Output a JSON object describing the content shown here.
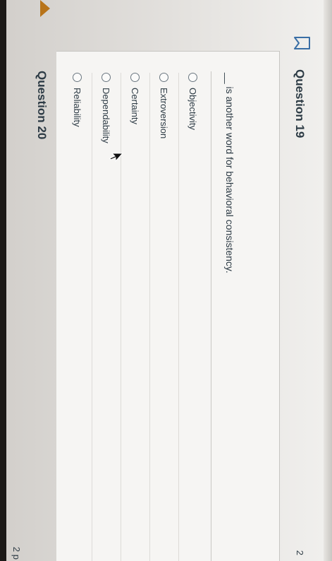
{
  "question": {
    "title": "Question 19",
    "points": "2",
    "text": "__ is another word for behavioral consistency.",
    "answers": [
      {
        "label": "Objectivity",
        "selected": false
      },
      {
        "label": "Extroversion",
        "selected": false
      },
      {
        "label": "Certainty",
        "selected": false
      },
      {
        "label": "Dependability",
        "selected": false
      },
      {
        "label": "Reliability",
        "selected": false
      }
    ]
  },
  "next_question": {
    "title": "Question 20",
    "points": "2 p"
  },
  "icons": {
    "bookmark": "bookmark-icon",
    "cursor": "cursor-icon"
  },
  "colors": {
    "text": "#2d3b45",
    "accent_tab": "#b8741a"
  }
}
